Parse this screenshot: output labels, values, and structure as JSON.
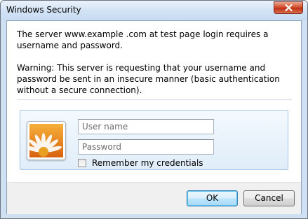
{
  "window": {
    "title": "Windows Security"
  },
  "message": {
    "line1": "The server www.example .com at test page login requires a username and password.",
    "warning": "Warning: This server is requesting that your username and password be sent in an insecure manner (basic authentication without a secure connection)."
  },
  "credentials": {
    "username": {
      "placeholder": "User name",
      "value": ""
    },
    "password": {
      "placeholder": "Password",
      "value": ""
    },
    "remember_label": "Remember my credentials",
    "remember_checked": false
  },
  "buttons": {
    "ok_label": "OK",
    "cancel_label": "Cancel"
  },
  "icons": {
    "close": "close-icon",
    "user_tile": "flower-user-tile-icon"
  },
  "colors": {
    "window_frame": "#cfe0f3",
    "close_button": "#c0321a",
    "panel_border": "#a7c6e6",
    "default_button_border": "#3c7fb1"
  }
}
